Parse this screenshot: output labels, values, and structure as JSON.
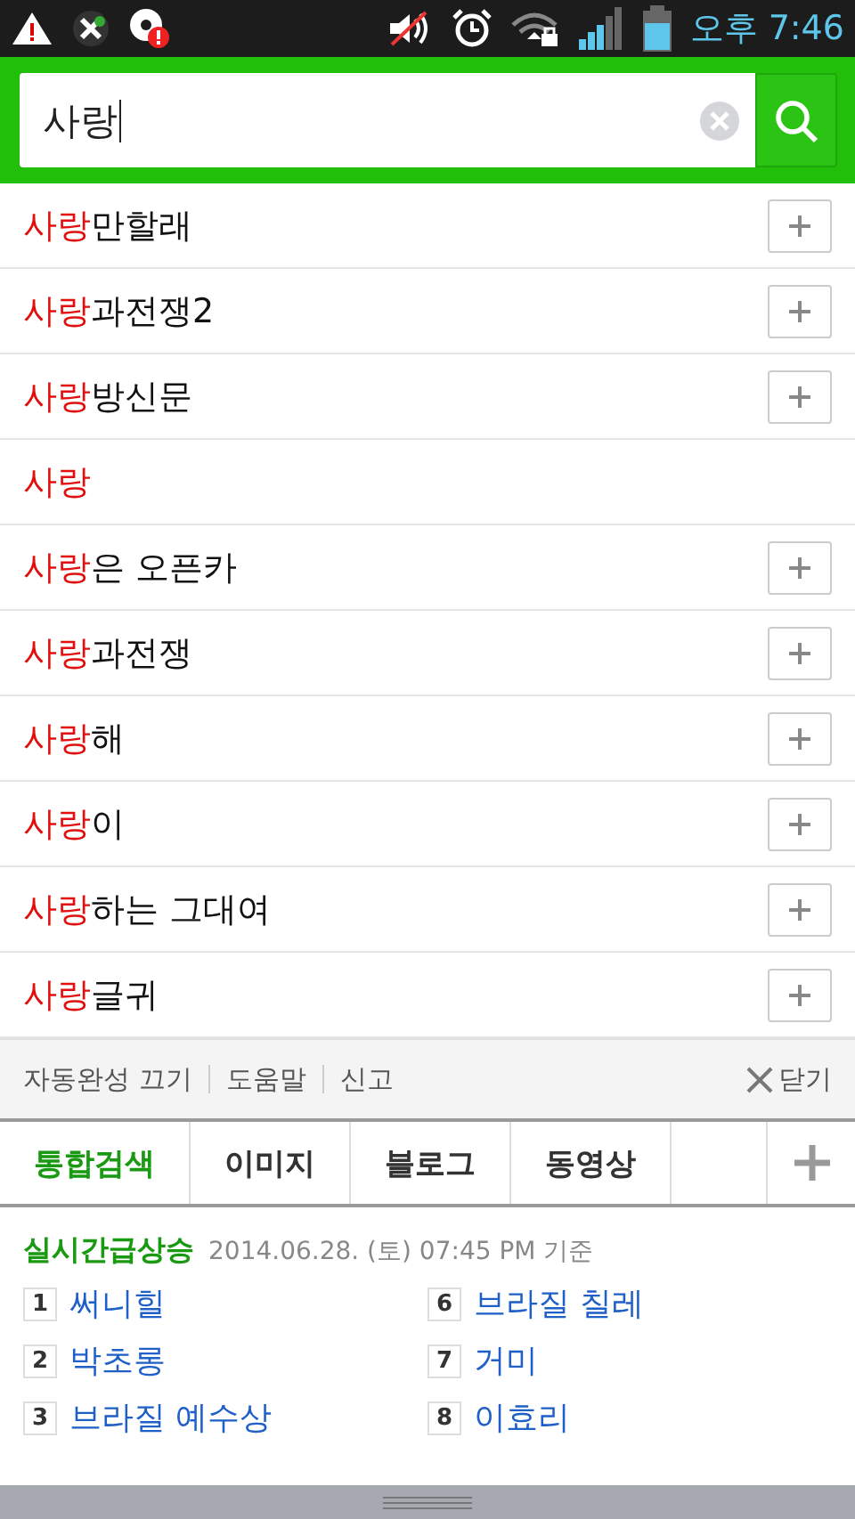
{
  "status_bar": {
    "time": "오후 7:46"
  },
  "search": {
    "value": "사랑"
  },
  "suggestions": [
    {
      "match": "사랑",
      "rest": "만할래",
      "addable": true
    },
    {
      "match": "사랑",
      "rest": "과전쟁2",
      "addable": true
    },
    {
      "match": "사랑",
      "rest": "방신문",
      "addable": true
    },
    {
      "match": "사랑",
      "addable": false
    },
    {
      "match": "사랑",
      "rest": "은 오픈카",
      "addable": true
    },
    {
      "match": "사랑",
      "rest": "과전쟁",
      "addable": true
    },
    {
      "match": "사랑",
      "rest": "해",
      "addable": true
    },
    {
      "match": "사랑",
      "rest": "이",
      "addable": true
    },
    {
      "match": "사랑",
      "rest": "하는 그대여",
      "addable": true
    },
    {
      "match": "사랑",
      "rest": "글귀",
      "addable": true
    }
  ],
  "footer_links": [
    "자동완성 끄기",
    "도움말",
    "신고"
  ],
  "close_label": "닫기",
  "tabs": [
    {
      "label": "통합검색",
      "selected": true
    },
    {
      "label": "이미지",
      "selected": false
    },
    {
      "label": "블로그",
      "selected": false
    },
    {
      "label": "동영상",
      "selected": false
    }
  ],
  "trending": {
    "title": "실시간급상승",
    "timestamp": "2014.06.28. (토) 07:45 PM 기준",
    "columns": [
      [
        {
          "rank": "1",
          "text": "써니힐"
        },
        {
          "rank": "2",
          "text": "박초롱"
        },
        {
          "rank": "3",
          "text": "브라질 예수상"
        }
      ],
      [
        {
          "rank": "6",
          "text": "브라질 칠레"
        },
        {
          "rank": "7",
          "text": "거미"
        },
        {
          "rank": "8",
          "text": "이효리"
        }
      ]
    ]
  }
}
